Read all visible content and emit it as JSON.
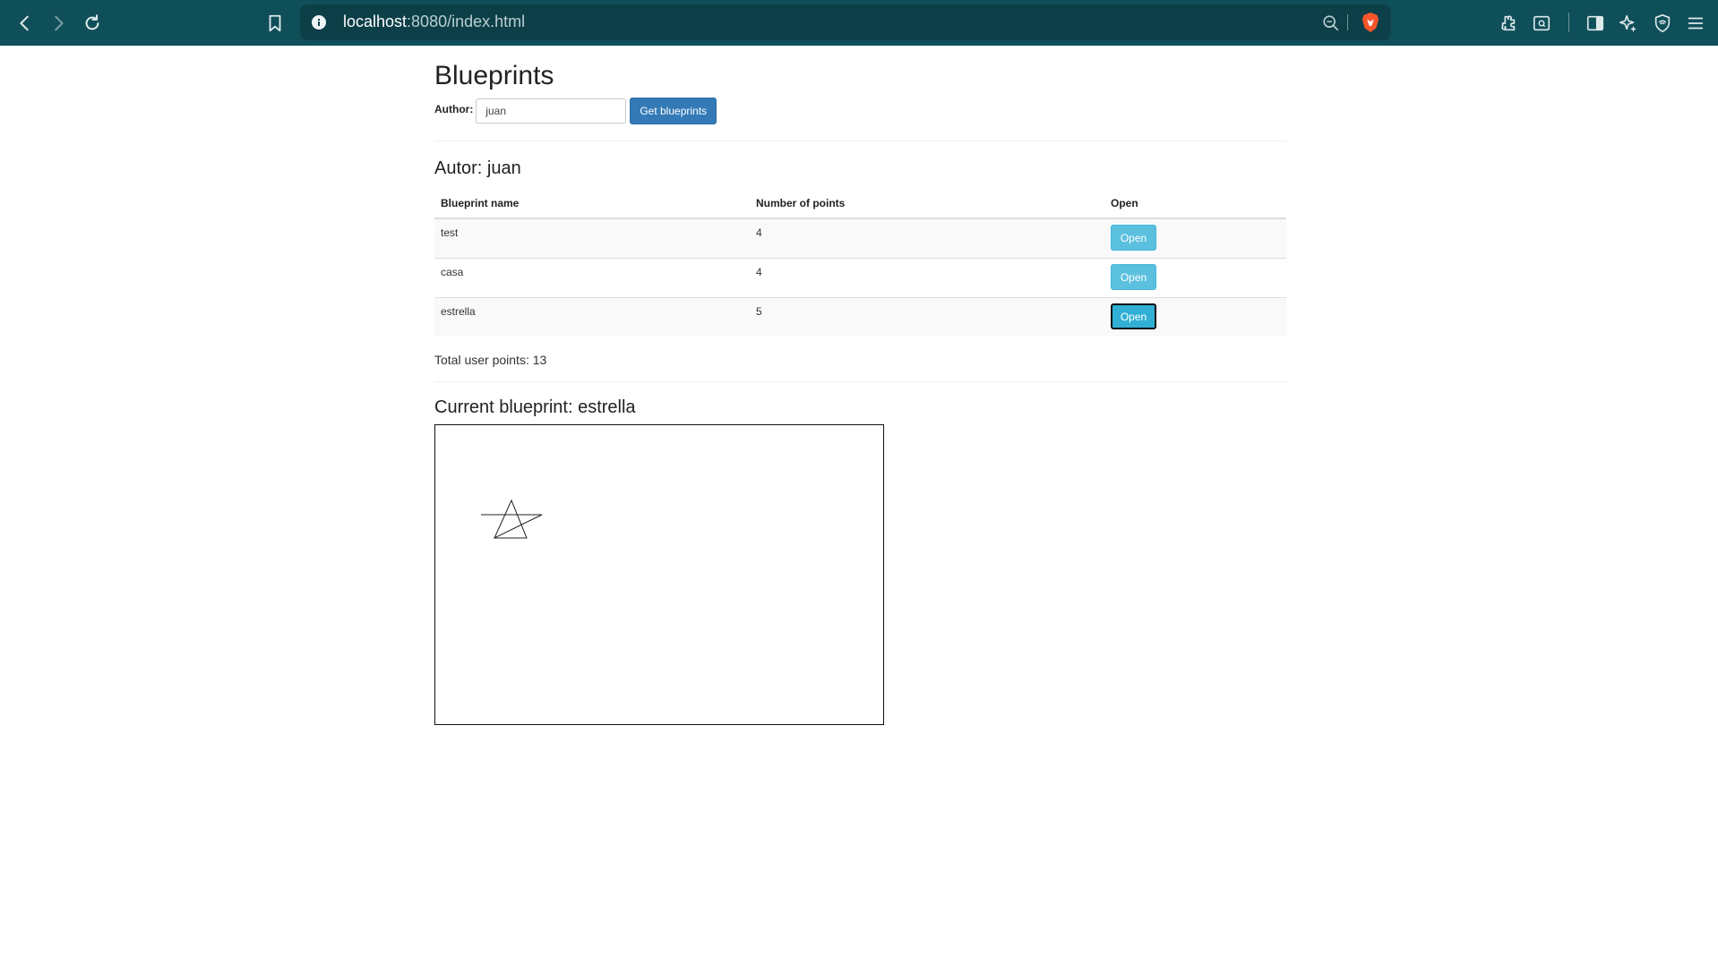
{
  "browser": {
    "url_host": "localhost",
    "url_rest": ":8080/index.html"
  },
  "page": {
    "title": "Blueprints",
    "author_label": "Author:",
    "author_value": "juan",
    "get_button": "Get blueprints",
    "author_heading": "Autor: juan",
    "table": {
      "headers": [
        "Blueprint name",
        "Number of points",
        "Open"
      ],
      "rows": [
        {
          "name": "test",
          "points": "4",
          "action": "Open"
        },
        {
          "name": "casa",
          "points": "4",
          "action": "Open"
        },
        {
          "name": "estrella",
          "points": "5",
          "action": "Open"
        }
      ]
    },
    "total_points": "Total user points: 13",
    "current_blueprint": "Current blueprint: estrella"
  },
  "icons": {
    "back": "back-arrow-icon",
    "forward": "forward-arrow-icon",
    "reload": "reload-icon",
    "bookmark": "bookmark-icon",
    "site_info": "info-icon",
    "zoom": "zoom-icon",
    "brave": "brave-shield-icon",
    "extensions": "extensions-icon",
    "screenshot": "screenshot-icon",
    "sidebar": "sidebar-icon",
    "leo": "leo-ai-icon",
    "vpn": "vpn-shield-icon",
    "menu": "menu-icon"
  },
  "colors": {
    "toolbar": "#0f4f5a",
    "urlbar": "#0d3f48",
    "primary_button": "#337ab7",
    "info_button": "#5bc0de"
  }
}
